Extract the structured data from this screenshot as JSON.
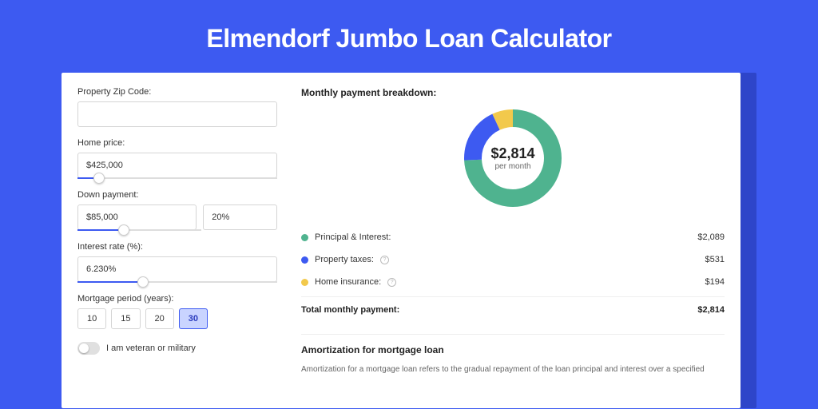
{
  "title": "Elmendorf Jumbo Loan Calculator",
  "form": {
    "zip_label": "Property Zip Code:",
    "zip_value": "",
    "home_price_label": "Home price:",
    "home_price_value": "$425,000",
    "home_price_slider_pct": 8,
    "down_label": "Down payment:",
    "down_value": "$85,000",
    "down_pct": "20%",
    "down_slider_pct": 20,
    "rate_label": "Interest rate (%):",
    "rate_value": "6.230%",
    "rate_slider_pct": 30,
    "period_label": "Mortgage period (years):",
    "periods": [
      "10",
      "15",
      "20",
      "30"
    ],
    "period_selected": 3,
    "veteran_label": "I am veteran or military"
  },
  "breakdown": {
    "title": "Monthly payment breakdown:",
    "donut_amount": "$2,814",
    "donut_sub": "per month",
    "items": [
      {
        "label": "Principal & Interest:",
        "value": "$2,089",
        "color": "#4fb38f",
        "info": false
      },
      {
        "label": "Property taxes:",
        "value": "$531",
        "color": "#3d5af1",
        "info": true
      },
      {
        "label": "Home insurance:",
        "value": "$194",
        "color": "#f2c94c",
        "info": true
      }
    ],
    "total_label": "Total monthly payment:",
    "total_value": "$2,814"
  },
  "amortization": {
    "title": "Amortization for mortgage loan",
    "text": "Amortization for a mortgage loan refers to the gradual repayment of the loan principal and interest over a specified"
  },
  "chart_data": {
    "type": "pie",
    "title": "Monthly payment breakdown",
    "series": [
      {
        "name": "Principal & Interest",
        "value": 2089,
        "color": "#4fb38f"
      },
      {
        "name": "Property taxes",
        "value": 531,
        "color": "#3d5af1"
      },
      {
        "name": "Home insurance",
        "value": 194,
        "color": "#f2c94c"
      }
    ],
    "total": 2814
  }
}
